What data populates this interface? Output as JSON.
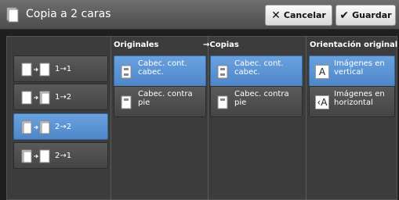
{
  "header": {
    "title": "Copia a 2 caras",
    "cancel_label": "Cancelar",
    "save_label": "Guardar"
  },
  "columns": {
    "originals": "Originales",
    "copies": "Copias",
    "orientation": "Orientación original"
  },
  "modes": [
    {
      "label": "1→1",
      "selected": false
    },
    {
      "label": "1→2",
      "selected": false
    },
    {
      "label": "2→2",
      "selected": true
    },
    {
      "label": "2→1",
      "selected": false
    }
  ],
  "originals_options": [
    {
      "label": "Cabec. cont. cabec.",
      "selected": true
    },
    {
      "label": "Cabec. contra pie",
      "selected": false
    }
  ],
  "copies_options": [
    {
      "label": "Cabec. cont. cabec.",
      "selected": true
    },
    {
      "label": "Cabec. contra pie",
      "selected": false
    }
  ],
  "orientation_options": [
    {
      "label": "Imágenes en vertical",
      "glyph": "A",
      "selected": true
    },
    {
      "label": "Imágenes en horizontal",
      "glyph": "‹A",
      "selected": false
    }
  ],
  "colors": {
    "accent": "#5a94d8",
    "panel": "#3c3c3c"
  }
}
